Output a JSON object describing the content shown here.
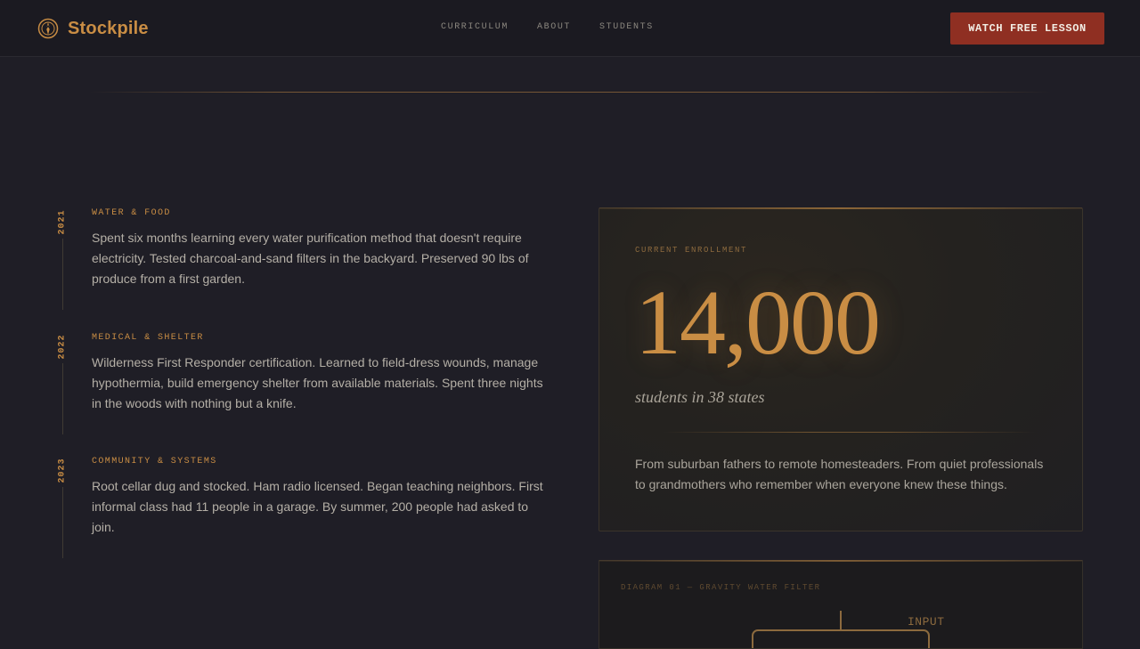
{
  "header": {
    "brand": "Stockpile",
    "brand_icon": "compass-emblem-icon",
    "nav": [
      "CURRICULUM",
      "ABOUT",
      "STUDENTS"
    ],
    "cta_label": "WATCH FREE LESSON"
  },
  "timeline": [
    {
      "year": "2021",
      "label": "WATER & FOOD",
      "text": "Spent six months learning every water purification method that doesn't require electricity. Tested charcoal-and-sand filters in the backyard. Preserved 90 lbs of produce from a first garden."
    },
    {
      "year": "2022",
      "label": "MEDICAL & SHELTER",
      "text": "Wilderness First Responder certification. Learned to field-dress wounds, manage hypothermia, build emergency shelter from available materials. Spent three nights in the woods with nothing but a knife."
    },
    {
      "year": "2023",
      "label": "COMMUNITY & SYSTEMS",
      "text": "Root cellar dug and stocked. Ham radio licensed. Began teaching neighbors. First informal class had 11 people in a garage. By summer, 200 people had asked to join."
    }
  ],
  "enrollment": {
    "eyebrow": "CURRENT ENROLLMENT",
    "number": "14,000",
    "subtitle": "students in 38 states",
    "body": "From suburban fathers to remote homesteaders. From quiet professionals to grandmothers who remember when everyone knew these things."
  },
  "diagram": {
    "label": "DIAGRAM 01 — GRAVITY WATER FILTER",
    "input_label": "INPUT"
  },
  "colors": {
    "accent": "#c98d44",
    "cta": "#8f2f22",
    "background": "#1f1e26"
  }
}
